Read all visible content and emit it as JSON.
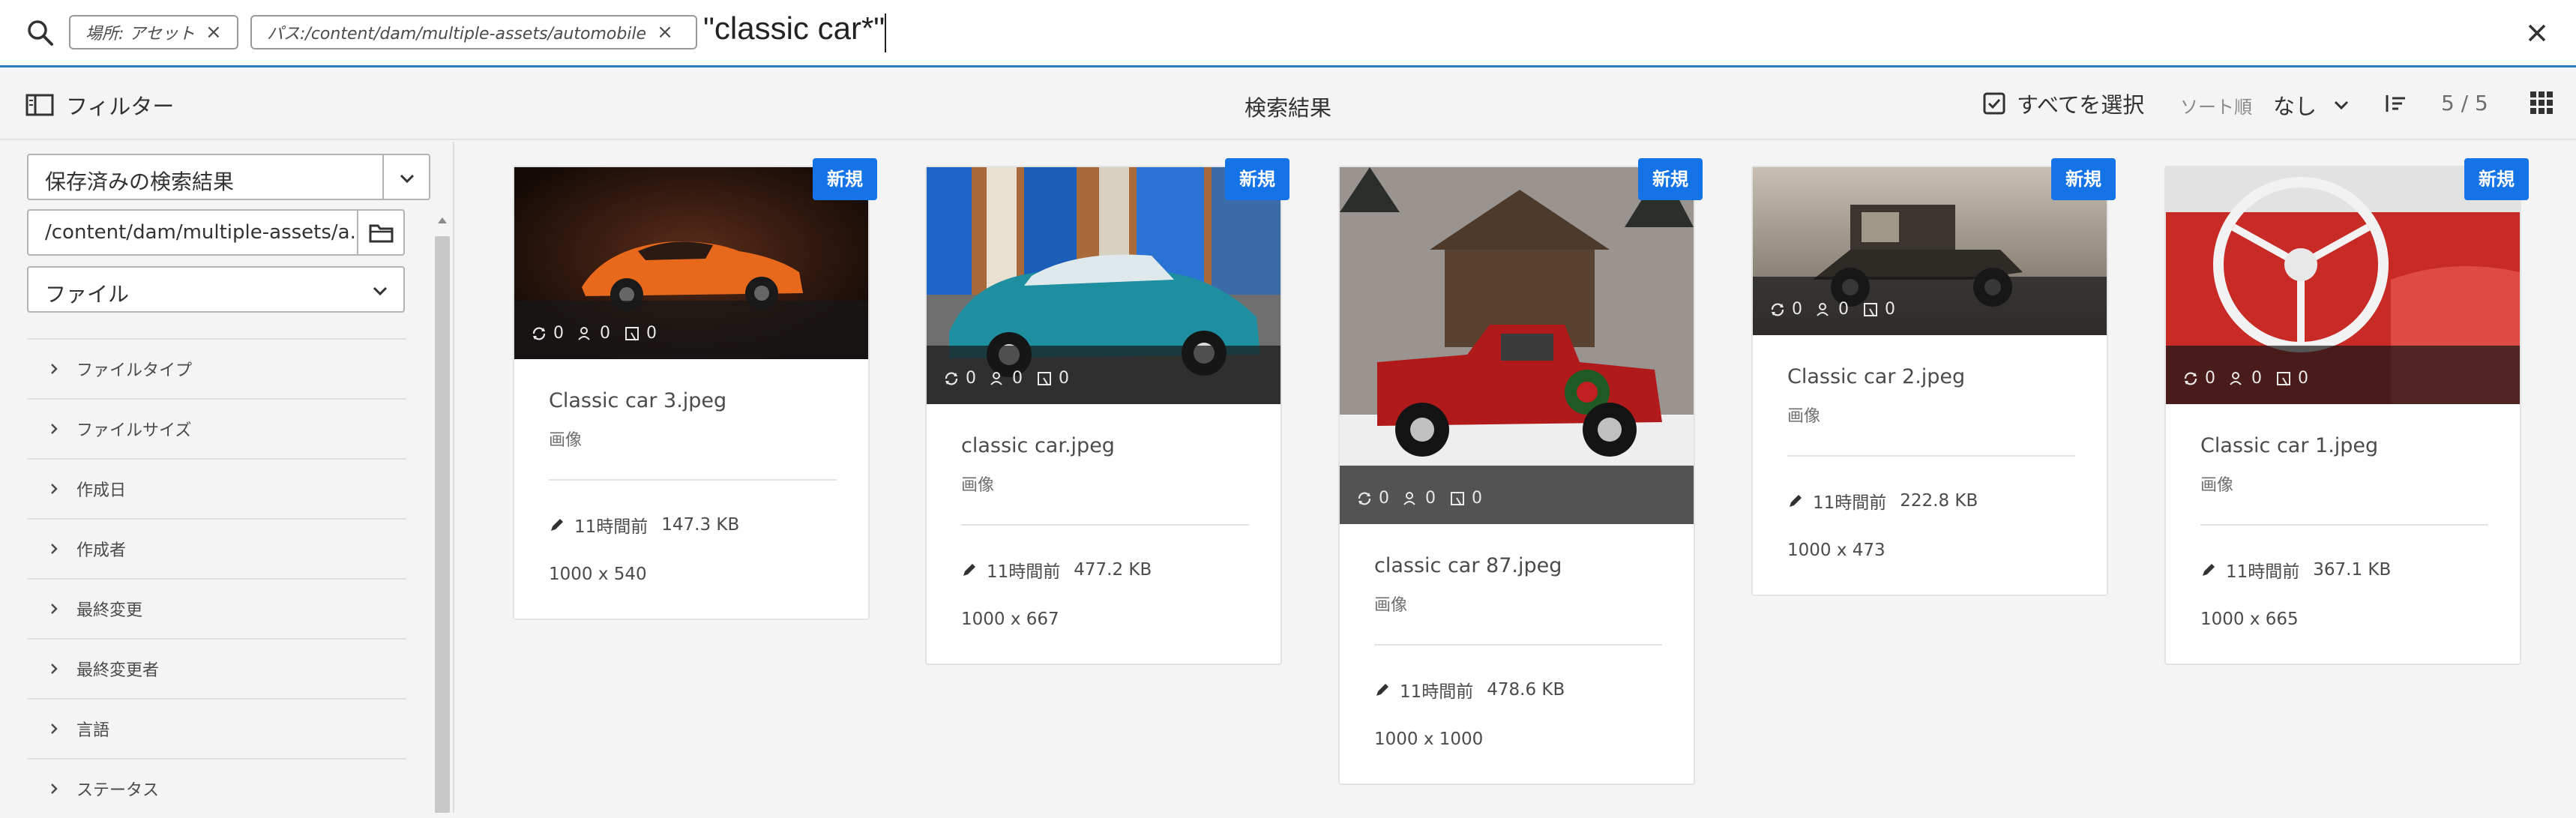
{
  "search": {
    "chip_location": "場所: アセット",
    "chip_path": "パス:/content/dam/multiple-assets/automobile",
    "query": "\"classic car*\""
  },
  "actionbar": {
    "filter_label": "フィルター",
    "title": "検索結果",
    "select_all": "すべてを選択",
    "sort_label": "ソート順",
    "sort_value": "なし",
    "count": "5 / 5"
  },
  "rail": {
    "saved_search": "保存済みの検索結果",
    "path": "/content/dam/multiple-assets/a...",
    "type": "ファイル",
    "facets": [
      "ファイルタイプ",
      "ファイルサイズ",
      "作成日",
      "作成者",
      "最終変更",
      "最終変更者",
      "言語",
      "ステータス"
    ]
  },
  "cards": [
    {
      "title": "Classic car 3.jpeg",
      "kind": "画像",
      "modified": "11時間前",
      "size": "147.3 KB",
      "dims": "1000 x 540",
      "badge": "新規",
      "comments": "0",
      "reviews": "0",
      "tasks": "0"
    },
    {
      "title": "classic car.jpeg",
      "kind": "画像",
      "modified": "11時間前",
      "size": "477.2 KB",
      "dims": "1000 x 667",
      "badge": "新規",
      "comments": "0",
      "reviews": "0",
      "tasks": "0"
    },
    {
      "title": "classic car 87.jpeg",
      "kind": "画像",
      "modified": "11時間前",
      "size": "478.6 KB",
      "dims": "1000 x 1000",
      "badge": "新規",
      "comments": "0",
      "reviews": "0",
      "tasks": "0"
    },
    {
      "title": "Classic car 2.jpeg",
      "kind": "画像",
      "modified": "11時間前",
      "size": "222.8 KB",
      "dims": "1000 x 473",
      "badge": "新規",
      "comments": "0",
      "reviews": "0",
      "tasks": "0"
    },
    {
      "title": "Classic car 1.jpeg",
      "kind": "画像",
      "modified": "11時間前",
      "size": "367.1 KB",
      "dims": "1000 x 665",
      "badge": "新規",
      "comments": "0",
      "reviews": "0",
      "tasks": "0"
    }
  ],
  "colors": {
    "accent": "#1473e6",
    "search_underline": "#2f7bc4"
  }
}
